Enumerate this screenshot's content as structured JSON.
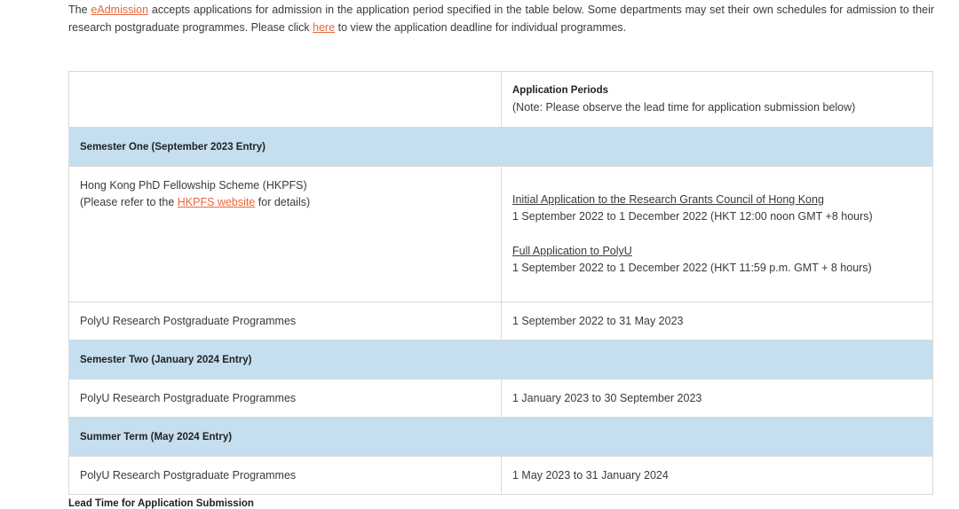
{
  "intro": {
    "before_link": "The ",
    "eadmission_link": "eAdmission",
    "middle": " accepts applications for admission in the application period specified in the table below. Some departments may set their own schedules for admission to their research postgraduate programmes. Please click ",
    "here_link": "here",
    "after_link": " to view the application deadline for individual programmes."
  },
  "table": {
    "header": {
      "title": "Application Periods",
      "note": "(Note: Please observe the lead time for application submission below)"
    },
    "semester_one": {
      "title": "Semester One (September 2023 Entry)",
      "hkpfs": {
        "name": "Hong Kong PhD Fellowship Scheme (HKPFS)",
        "refer_before": "(Please refer to the ",
        "refer_link": "HKPFS website",
        "refer_after": " for details)",
        "initial_link": "Initial Application to the Research Grants Council of Hong Kong",
        "initial_period": "1 September 2022 to 1 December 2022 (HKT 12:00 noon GMT +8 hours)",
        "full_link": "Full Application to PolyU",
        "full_period": "1 September 2022 to 1 December 2022 (HKT 11:59 p.m. GMT + 8 hours)"
      },
      "polyu": {
        "name": "PolyU Research Postgraduate Programmes",
        "period": "1 September 2022 to 31 May 2023"
      }
    },
    "semester_two": {
      "title": "Semester Two (January 2024 Entry)",
      "polyu": {
        "name": "PolyU Research Postgraduate Programmes",
        "period": "1 January 2023 to 30 September 2023"
      }
    },
    "summer": {
      "title": "Summer Term (May 2024 Entry)",
      "polyu": {
        "name": "PolyU Research Postgraduate Programmes",
        "period": "1 May 2023 to 31 January 2024"
      }
    }
  },
  "lead_time_heading": "Lead Time for Application Submission",
  "colors": {
    "link": "#e8663a",
    "section_bg": "#c5dff0",
    "border": "#d9d9d9"
  }
}
